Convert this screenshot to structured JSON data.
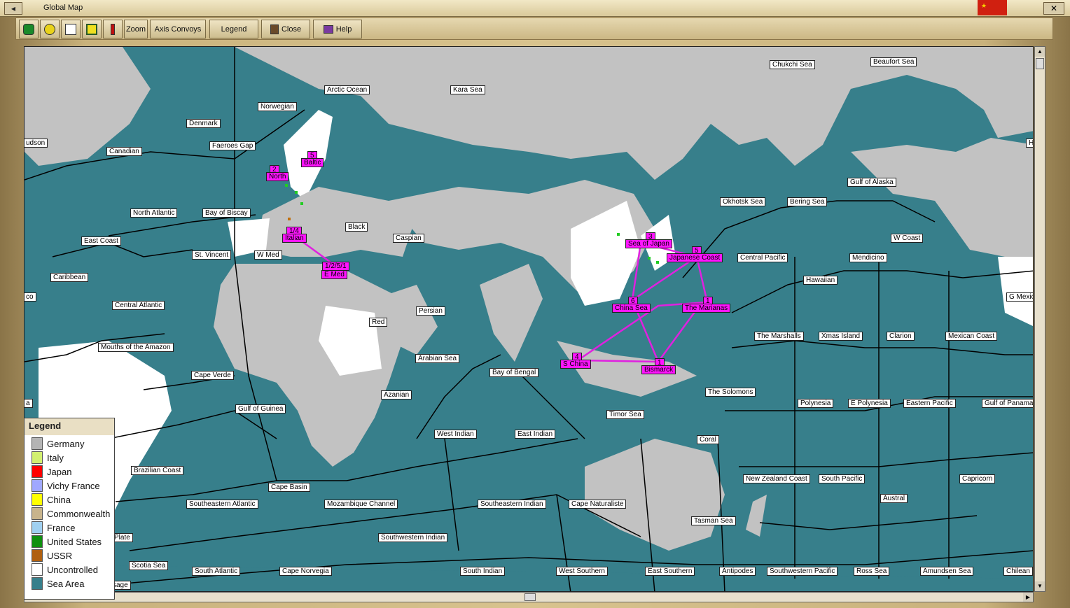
{
  "window": {
    "title": "Global Map"
  },
  "toolbar": {
    "zoom_label": "Zoom",
    "axis_convoys_label": "Axis Convoys",
    "legend_label": "Legend",
    "close_label": "Close",
    "help_label": "Help"
  },
  "legend": {
    "title": "Legend",
    "items": [
      {
        "label": "Germany",
        "color": "#b4b4b4"
      },
      {
        "label": "Italy",
        "color": "#d2f070"
      },
      {
        "label": "Japan",
        "color": "#ff0000"
      },
      {
        "label": "Vichy France",
        "color": "#a0a8ff"
      },
      {
        "label": "China",
        "color": "#ffff00"
      },
      {
        "label": "Commonwealth",
        "color": "#c8b48c"
      },
      {
        "label": "France",
        "color": "#a0d0f0"
      },
      {
        "label": "United States",
        "color": "#109010"
      },
      {
        "label": "USSR",
        "color": "#b06010"
      },
      {
        "label": "Uncontrolled",
        "color": "#ffffff"
      },
      {
        "label": "Sea Area",
        "color": "#377f8b"
      }
    ]
  },
  "sea_areas": [
    "Arctic Ocean",
    "Kara Sea",
    "Chukchi Sea",
    "Beaufort Sea",
    "Norwegian",
    "Denmark",
    "udson",
    "Canadian",
    "Faeroes Gap",
    "North Atlantic",
    "Bay of Biscay",
    "East Coast",
    "St. Vincent",
    "W Med",
    "Caribbean",
    "Central Atlantic",
    "Black",
    "Caspian",
    "Persian",
    "Red",
    "Mouths of the Amazon",
    "Cape Verde",
    "Gulf of Guinea",
    "Arabian Sea",
    "Azanian",
    "Bay of Bengal",
    "Okhotsk Sea",
    "Bering Sea",
    "Gulf of Alaska",
    "W Coast",
    "Central Pacific",
    "Mendicino",
    "Hawaiian",
    "G Mexic",
    "The Marshalls",
    "Xmas Island",
    "Clarion",
    "Mexican Coast",
    "The Solomons",
    "Polynesia",
    "E Polynesia",
    "Eastern Pacific",
    "Gulf of Panama",
    "Timor Sea",
    "Coral",
    "West Indian",
    "East Indian",
    "Brazilian Coast",
    "Cape Basin",
    "New Zealand Coast",
    "South Pacific",
    "Capricorn",
    "Austral",
    "Southeastern Atlantic",
    "Mozambique Channel",
    "Southeastern Indian",
    "Cape Naturaliste",
    "Tasman Sea",
    "Southwestern Indian",
    "Plate",
    "Scotia Sea",
    "South Atlantic",
    "Cape Norvegia",
    "South Indian",
    "West Southern",
    "East Southern",
    "Antipodes",
    "Southwestern Pacific",
    "Ross Sea",
    "Amundsen Sea",
    "Chilean",
    "sage",
    "co",
    "Hu",
    "a"
  ],
  "convoys": [
    {
      "label": "Baltic",
      "num": "5"
    },
    {
      "label": "North",
      "num": "2"
    },
    {
      "label": "Italian",
      "num": "1/4"
    },
    {
      "label": "E Med",
      "num": "1/2/5/1"
    },
    {
      "label": "Sea of Japan",
      "num": "3"
    },
    {
      "label": "Japanese Coast",
      "num": "5"
    },
    {
      "label": "China Sea",
      "num": "6"
    },
    {
      "label": "The Marianas",
      "num": "1"
    },
    {
      "label": "S China",
      "num": "4"
    },
    {
      "label": "Bismarck",
      "num": "1"
    }
  ]
}
